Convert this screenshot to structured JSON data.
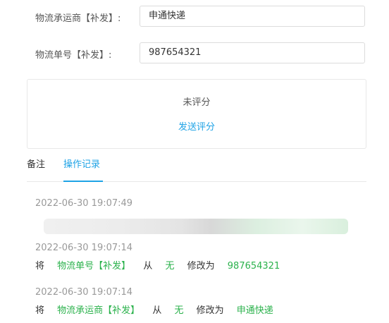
{
  "form": {
    "carrier_label": "物流承运商【补发】:",
    "carrier_value": "申通快递",
    "tracking_label": "物流单号【补发】:",
    "tracking_value": "987654321"
  },
  "rating": {
    "status": "未评分",
    "send_label": "发送评分"
  },
  "tabs": [
    {
      "label": "备注",
      "active": false
    },
    {
      "label": "操作记录",
      "active": true
    }
  ],
  "logs": [
    {
      "time": "2022-06-30 19:07:49"
    },
    {
      "time": "2022-06-30 19:07:14",
      "prefix": "将",
      "field": "物流单号【补发】",
      "from_word": "从",
      "old": "无",
      "change_word": "修改为",
      "new": "987654321"
    },
    {
      "time": "2022-06-30 19:07:14",
      "prefix": "将",
      "field": "物流承运商【补发】",
      "from_word": "从",
      "old": "无",
      "change_word": "修改为",
      "new": "申通快递"
    }
  ],
  "colors": {
    "accent": "#1fa3e6",
    "green": "#2bb24c"
  }
}
